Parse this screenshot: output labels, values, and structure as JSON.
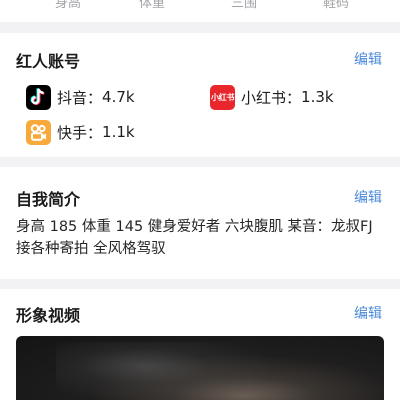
{
  "stats": {
    "labels": [
      "身高",
      "体重",
      "三围",
      "鞋码"
    ]
  },
  "influencer_accounts": {
    "title": "红人账号",
    "edit_label": "编辑",
    "accounts": [
      {
        "platform": "抖音",
        "separator": "：",
        "count": "4.7k",
        "icon": "douyin-icon"
      },
      {
        "platform": "小红书",
        "separator": "：",
        "count": "1.3k",
        "icon": "xiaohongshu-icon",
        "icon_text": "小红书"
      },
      {
        "platform": "快手",
        "separator": "：",
        "count": "1.1k",
        "icon": "kuaishou-icon"
      }
    ]
  },
  "self_intro": {
    "title": "自我简介",
    "edit_label": "编辑",
    "text": "身高 185 体重 145 健身爱好者 六块腹肌 某音：龙叔FJ接各种寄拍 全风格驾驭"
  },
  "image_video": {
    "title": "形象视频",
    "edit_label": "编辑"
  },
  "colors": {
    "accent": "#4a8ad9",
    "background": "#f2f2f4",
    "douyin": "#000000",
    "xiaohongshu": "#e8262b",
    "kuaishou": "#f7a93b"
  }
}
